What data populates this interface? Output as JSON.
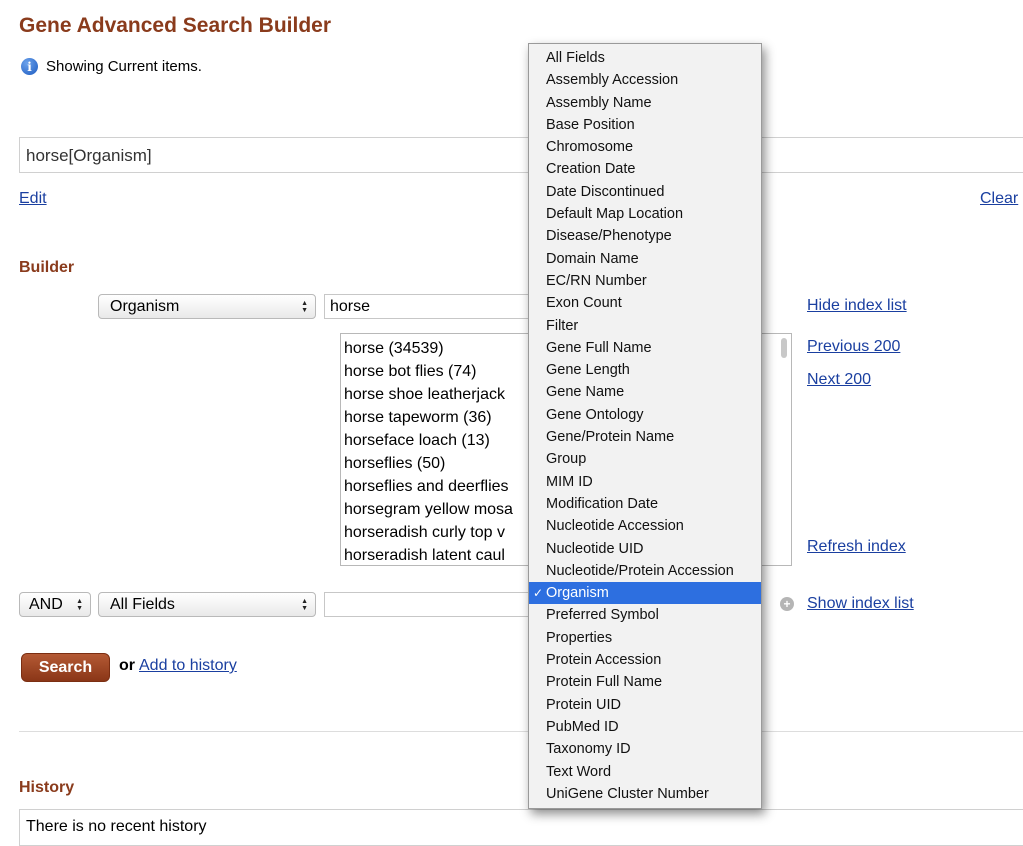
{
  "header": {
    "title": "Gene Advanced Search Builder",
    "info_text": "Showing Current items."
  },
  "query": {
    "value": "horse[Organism]",
    "edit_label": "Edit",
    "clear_label": "Clear"
  },
  "builder": {
    "label": "Builder",
    "row1": {
      "field": "Organism",
      "term": "horse",
      "hide_index_label": "Hide index list",
      "previous_label": "Previous 200",
      "next_label": "Next 200",
      "refresh_label": "Refresh index",
      "index_items": [
        "horse (34539)",
        "horse bot flies (74)",
        "horse shoe leatherjack",
        "horse tapeworm (36)",
        "horseface loach (13)",
        "horseflies (50)",
        "horseflies and deerflies",
        "horsegram yellow mosa",
        "horseradish curly top v",
        "horseradish latent caul"
      ]
    },
    "row2": {
      "operator": "AND",
      "field": "All Fields",
      "term": "",
      "show_index_label": "Show index list"
    },
    "search_label": "Search",
    "or_text": "or",
    "add_history_label": "Add to history"
  },
  "history": {
    "label": "History",
    "empty_text": "There is no recent history"
  },
  "field_dropdown": {
    "selected": "Organism",
    "check_glyph": "✓",
    "options": [
      "All Fields",
      "Assembly Accession",
      "Assembly Name",
      "Base Position",
      "Chromosome",
      "Creation Date",
      "Date Discontinued",
      "Default Map Location",
      "Disease/Phenotype",
      "Domain Name",
      "EC/RN Number",
      "Exon Count",
      "Filter",
      "Gene Full Name",
      "Gene Length",
      "Gene Name",
      "Gene Ontology",
      "Gene/Protein Name",
      "Group",
      "MIM ID",
      "Modification Date",
      "Nucleotide Accession",
      "Nucleotide UID",
      "Nucleotide/Protein Accession",
      "Organism",
      "Preferred Symbol",
      "Properties",
      "Protein Accession",
      "Protein Full Name",
      "Protein UID",
      "PubMed ID",
      "Taxonomy ID",
      "Text Word",
      "UniGene Cluster Number"
    ]
  },
  "colors": {
    "title": "#8a3b1c",
    "link": "#1a3fa0",
    "selected_option": "#2d6fe0",
    "search_button": "#9c4322"
  },
  "icons": {
    "info": "info-icon",
    "select_arrow": "up-down-arrow-icon",
    "plus": "plus-circle-icon"
  }
}
